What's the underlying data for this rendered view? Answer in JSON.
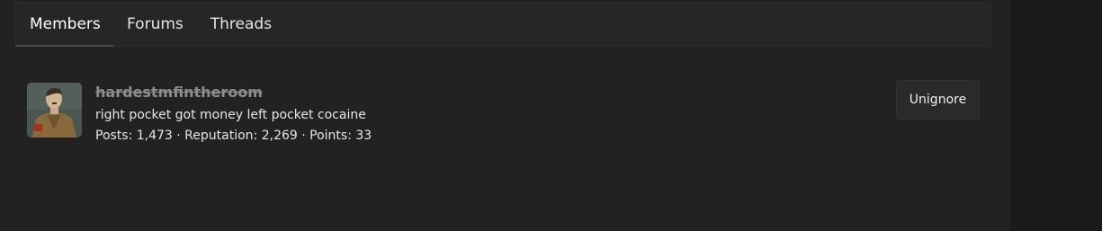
{
  "tabs": [
    {
      "label": "Members",
      "active": true
    },
    {
      "label": "Forums",
      "active": false
    },
    {
      "label": "Threads",
      "active": false
    }
  ],
  "member": {
    "username": "hardestmfintheroom",
    "title": "right pocket got money left pocket cocaine",
    "stats": "Posts: 1,473 · Reputation: 2,269 · Points: 33",
    "avatar_icon": "user-avatar-photo"
  },
  "actions": {
    "unignore_label": "Unignore"
  },
  "colors": {
    "background": "#222222",
    "gutter": "#1b1b1b",
    "tab_bar": "#262626",
    "text": "#e6e6e6",
    "ignored_username": "#8d8d8d",
    "button_bg": "#2a2a2a"
  }
}
